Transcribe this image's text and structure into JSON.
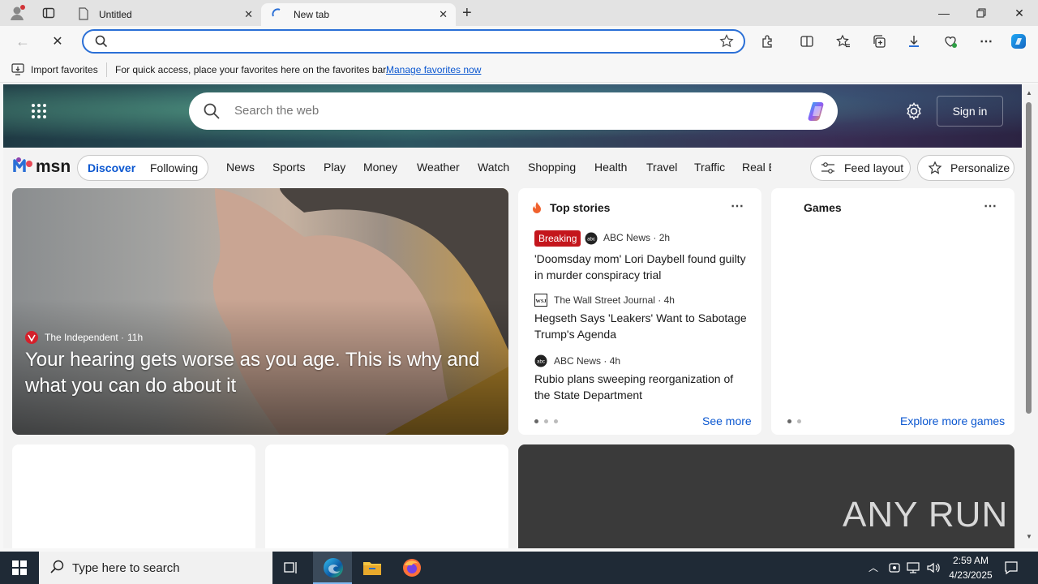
{
  "browser": {
    "tabs": [
      {
        "label": "Untitled",
        "active": false
      },
      {
        "label": "New tab",
        "active": true
      }
    ],
    "favorites_bar": {
      "import_label": "Import favorites",
      "hint": "For quick access, place your favorites here on the favorites bar.",
      "manage_link": "Manage favorites now"
    }
  },
  "msn": {
    "search_placeholder": "Search the web",
    "sign_in": "Sign in",
    "logo": "msn",
    "feed_tabs": [
      "Discover",
      "Following"
    ],
    "nav": [
      "News",
      "Sports",
      "Play",
      "Money",
      "Weather",
      "Watch",
      "Shopping",
      "Health",
      "Travel",
      "Traffic",
      "Real E"
    ],
    "feed_layout": "Feed layout",
    "personalize": "Personalize",
    "hero": {
      "source": "The Independent",
      "age": "11h",
      "headline": "Your hearing gets worse as you age. This is why and what you can do about it"
    },
    "top_stories": {
      "title": "Top stories",
      "see_more": "See more",
      "stories": [
        {
          "badge": "Breaking",
          "source": "ABC News",
          "age": "2h",
          "title": "'Doomsday mom' Lori Daybell found guilty in murder conspiracy trial"
        },
        {
          "badge": "",
          "source": "The Wall Street Journal",
          "age": "4h",
          "title": "Hegseth Says 'Leakers' Want to Sabotage Trump's Agenda"
        },
        {
          "badge": "",
          "source": "ABC News",
          "age": "4h",
          "title": "Rubio plans sweeping reorganization of the State Department"
        }
      ]
    },
    "games": {
      "title": "Games",
      "explore": "Explore more games"
    },
    "watermark": "ANY RUN"
  },
  "taskbar": {
    "search_placeholder": "Type here to search",
    "time": "2:59 AM",
    "date": "4/23/2025"
  },
  "colors": {
    "accent": "#2a6fd6",
    "breaking": "#c4161c",
    "link": "#0b57d0",
    "taskbar": "#1f2a36"
  }
}
